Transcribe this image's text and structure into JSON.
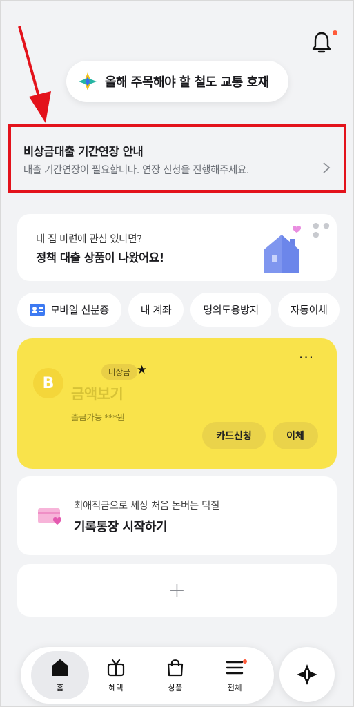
{
  "header": {
    "bell_icon": "bell-icon",
    "has_new_notification": true
  },
  "notice_pill": {
    "icon": "sparkle-icon",
    "text": "올해 주목해야 할 철도 교통 호재"
  },
  "alert": {
    "title": "비상금대출 기간연장 안내",
    "description": "대출 기간연장이 필요합니다. 연장 신청을 진행해주세요.",
    "highlight_color": "#e3121b",
    "chevron_icon": "chevron-right-icon"
  },
  "promo": {
    "line1": "내 집 마련에 관심 있다면?",
    "line2": "정책 대출 상품이 나왔어요!",
    "illustration": "house-heart-icon"
  },
  "quick_menu": [
    {
      "label": "모바일 신분증",
      "icon": "id-card-icon"
    },
    {
      "label": "내 계좌"
    },
    {
      "label": "명의도용방지"
    },
    {
      "label": "자동이체"
    }
  ],
  "account_card": {
    "background_color": "#f9e34b",
    "logo_text": "B",
    "tag": "비상금",
    "star": "★",
    "amount_label": "금액보기",
    "available": "출금가능 ***원",
    "menu_icon": "···",
    "buttons": {
      "card_apply": "카드신청",
      "transfer": "이체"
    }
  },
  "savings": {
    "icon": "pink-card-heart-icon",
    "subtitle": "최애적금으로 세상 처음 돈버는 덕질",
    "title": "기록통장 시작하기"
  },
  "add_card": {
    "plus": "+"
  },
  "tabbar": {
    "tabs": [
      {
        "label": "홈",
        "icon": "home-icon",
        "active": true
      },
      {
        "label": "혜택",
        "icon": "tv-gift-icon",
        "active": false
      },
      {
        "label": "상품",
        "icon": "shopping-bag-icon",
        "active": false
      },
      {
        "label": "전체",
        "icon": "menu-icon",
        "active": false,
        "badge": true
      }
    ],
    "fab_icon": "ai-sparkle-icon"
  }
}
